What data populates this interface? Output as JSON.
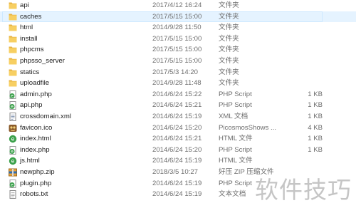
{
  "files": [
    {
      "name": "api",
      "date": "2017/4/12 16:24",
      "type": "文件夹",
      "size": "",
      "icon": "folder-icon"
    },
    {
      "name": "caches",
      "date": "2017/5/15 15:00",
      "type": "文件夹",
      "size": "",
      "icon": "folder-icon",
      "selected": true
    },
    {
      "name": "html",
      "date": "2014/9/28 11:50",
      "type": "文件夹",
      "size": "",
      "icon": "folder-icon"
    },
    {
      "name": "install",
      "date": "2017/5/15 15:00",
      "type": "文件夹",
      "size": "",
      "icon": "folder-icon"
    },
    {
      "name": "phpcms",
      "date": "2017/5/15 15:00",
      "type": "文件夹",
      "size": "",
      "icon": "folder-icon"
    },
    {
      "name": "phpsso_server",
      "date": "2017/5/15 15:00",
      "type": "文件夹",
      "size": "",
      "icon": "folder-icon"
    },
    {
      "name": "statics",
      "date": "2017/5/3 14:20",
      "type": "文件夹",
      "size": "",
      "icon": "folder-icon"
    },
    {
      "name": "uploadfile",
      "date": "2014/9/28 11:48",
      "type": "文件夹",
      "size": "",
      "icon": "folder-icon"
    },
    {
      "name": "admin.php",
      "date": "2014/6/24 15:22",
      "type": "PHP Script",
      "size": "1 KB",
      "icon": "php-script-icon"
    },
    {
      "name": "api.php",
      "date": "2014/6/24 15:21",
      "type": "PHP Script",
      "size": "1 KB",
      "icon": "php-script-icon"
    },
    {
      "name": "crossdomain.xml",
      "date": "2014/6/24 15:19",
      "type": "XML 文档",
      "size": "1 KB",
      "icon": "xml-document-icon"
    },
    {
      "name": "favicon.ico",
      "date": "2014/6/24 15:20",
      "type": "PicosmosShows ...",
      "size": "4 KB",
      "icon": "ico-image-icon"
    },
    {
      "name": "index.html",
      "date": "2014/6/24 15:21",
      "type": "HTML 文件",
      "size": "1 KB",
      "icon": "html-file-icon"
    },
    {
      "name": "index.php",
      "date": "2014/6/24 15:20",
      "type": "PHP Script",
      "size": "1 KB",
      "icon": "php-script-icon"
    },
    {
      "name": "js.html",
      "date": "2014/6/24 15:19",
      "type": "HTML 文件",
      "size": "",
      "icon": "html-file-icon"
    },
    {
      "name": "newphp.zip",
      "date": "2018/3/5 10:27",
      "type": "好压 ZIP 压缩文件",
      "size": "",
      "icon": "zip-archive-icon"
    },
    {
      "name": "plugin.php",
      "date": "2014/6/24 15:19",
      "type": "PHP Script",
      "size": "",
      "icon": "php-script-icon"
    },
    {
      "name": "robots.txt",
      "date": "2014/6/24 15:19",
      "type": "文本文档",
      "size": "",
      "icon": "text-file-icon"
    }
  ],
  "watermark": "软件技巧",
  "colors": {
    "folder": "#f4c24f",
    "selection": "#e5f3ff",
    "meta_text": "#6d6d6d"
  }
}
